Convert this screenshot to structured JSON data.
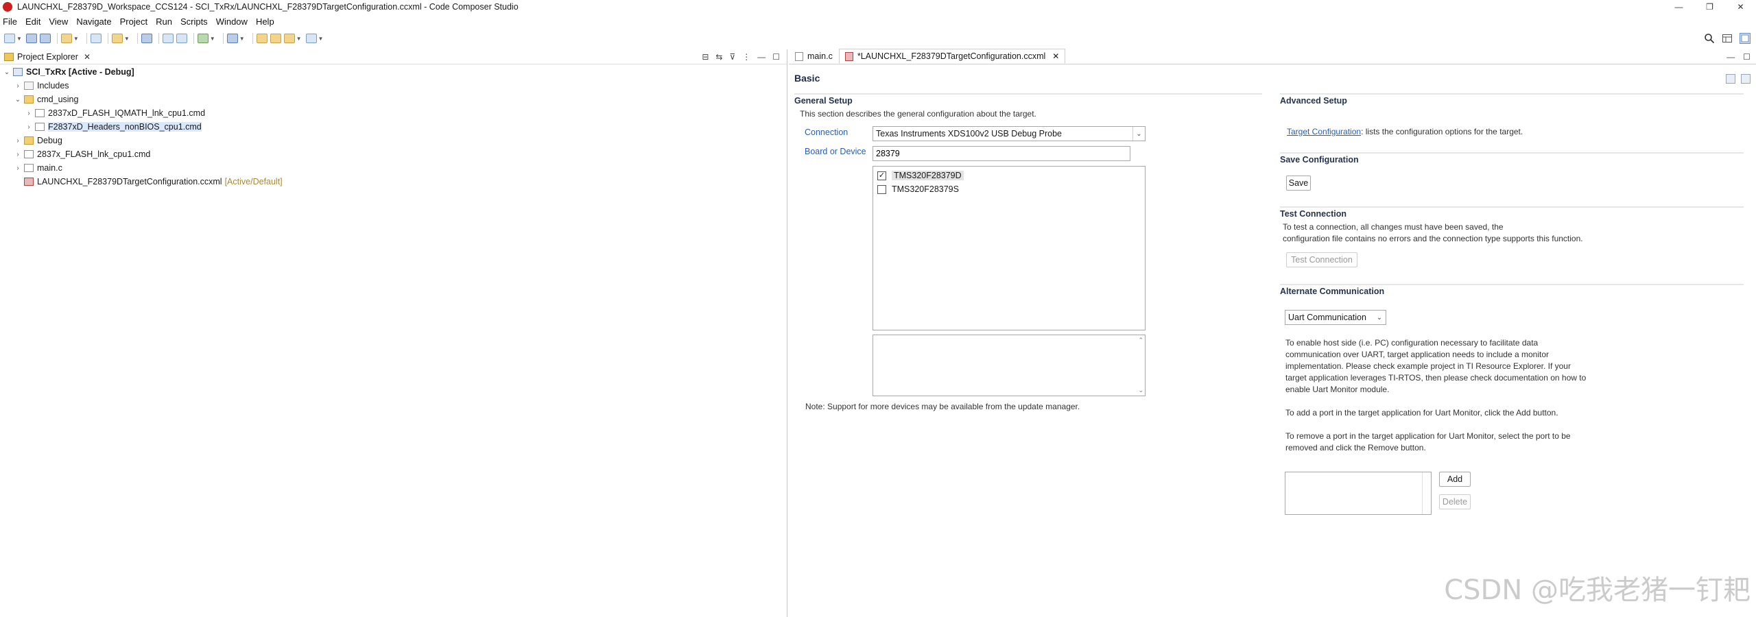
{
  "window": {
    "title": "LAUNCHXL_F28379D_Workspace_CCS124 - SCI_TxRx/LAUNCHXL_F28379DTargetConfiguration.ccxml - Code Composer Studio",
    "controls": [
      "—",
      "❐",
      "✕"
    ]
  },
  "menu": [
    "File",
    "Edit",
    "View",
    "Navigate",
    "Project",
    "Run",
    "Scripts",
    "Window",
    "Help"
  ],
  "project_explorer": {
    "tab_label": "Project Explorer",
    "tree": [
      {
        "label": "SCI_TxRx  [Active - Debug]",
        "level": 0,
        "expanded": true,
        "icon": "project-icon",
        "bold": true
      },
      {
        "label": "Includes",
        "level": 1,
        "expanded": false,
        "icon": "includes-icon"
      },
      {
        "label": "cmd_using",
        "level": 1,
        "expanded": true,
        "icon": "folder-icon"
      },
      {
        "label": "2837xD_FLASH_IQMATH_lnk_cpu1.cmd",
        "level": 2,
        "expanded": false,
        "icon": "file-icon"
      },
      {
        "label": "F2837xD_Headers_nonBIOS_cpu1.cmd",
        "level": 2,
        "expanded": false,
        "icon": "file-icon",
        "selected": true
      },
      {
        "label": "Debug",
        "level": 1,
        "expanded": false,
        "icon": "folder-icon"
      },
      {
        "label": "2837x_FLASH_lnk_cpu1.cmd",
        "level": 1,
        "expanded": false,
        "icon": "file-icon"
      },
      {
        "label": "main.c",
        "level": 1,
        "expanded": false,
        "icon": "c-file-icon"
      },
      {
        "label": "LAUNCHXL_F28379DTargetConfiguration.ccxml",
        "level": 1,
        "expanded": null,
        "icon": "ccxml-icon",
        "decoration": "[Active/Default]"
      }
    ]
  },
  "editor": {
    "tabs": [
      {
        "label": "main.c",
        "active": false
      },
      {
        "label": "*LAUNCHXL_F28379DTargetConfiguration.ccxml",
        "active": true
      }
    ],
    "heading": "Basic",
    "general_setup": {
      "title": "General Setup",
      "description": "This section describes the general configuration about the target.",
      "connection_label": "Connection",
      "connection_value": "Texas Instruments XDS100v2 USB Debug Probe",
      "board_label": "Board or Device",
      "board_value": "28379",
      "devices": [
        {
          "label": "TMS320F28379D",
          "checked": true
        },
        {
          "label": "TMS320F28379S",
          "checked": false
        }
      ],
      "note": "Note: Support for more devices may be available from the update manager."
    },
    "advanced_setup": {
      "title": "Advanced Setup",
      "link": "Target Configuration",
      "link_suffix": ": lists the configuration options for the target."
    },
    "save_configuration": {
      "title": "Save Configuration",
      "button": "Save"
    },
    "test_connection": {
      "title": "Test Connection",
      "description_line1": "To test a connection, all changes must have been saved, the",
      "description_line2": "configuration file contains no errors and the connection type supports this function.",
      "button": "Test Connection"
    },
    "alternate_communication": {
      "title": "Alternate Communication",
      "select_value": "Uart Communication",
      "para1": [
        "To enable host side (i.e. PC) configuration necessary to facilitate data",
        "communication over UART, target application needs to include a monitor",
        "implementation. Please check example project in TI Resource Explorer. If your",
        "target application leverages TI-RTOS, then please check documentation on how to",
        "enable Uart Monitor module."
      ],
      "para2": "To add a port in the target application for Uart Monitor, click the Add button.",
      "para3": [
        "To remove a port in the target application for Uart Monitor, select the port to be",
        "removed and click the Remove button."
      ],
      "add_button": "Add",
      "delete_button": "Delete"
    }
  },
  "watermark": "CSDN @吃我老猪一钉耙"
}
